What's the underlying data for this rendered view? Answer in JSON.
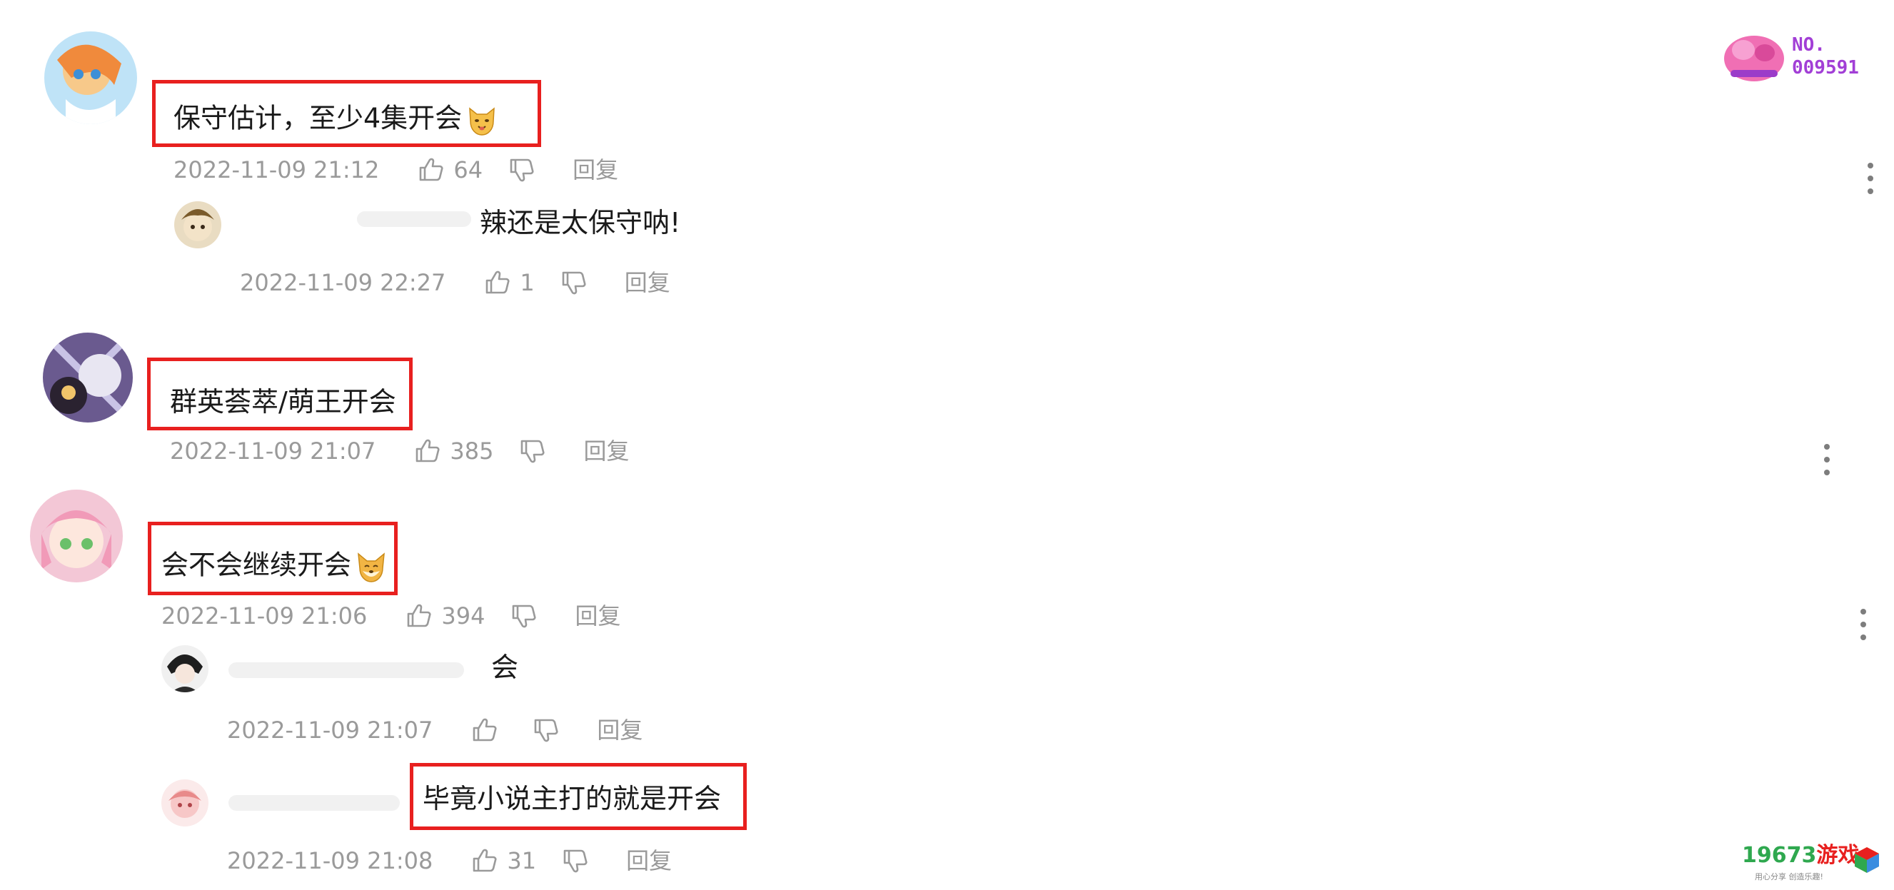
{
  "badge": {
    "line1": "NO.",
    "line2": "009591"
  },
  "watermark": {
    "brand_digits": "19673",
    "brand_cn": "游戏",
    "tagline": "用心分享 创造乐趣!"
  },
  "icons": {
    "like": "thumbs-up-icon",
    "dislike": "thumbs-down-icon",
    "more": "more-vertical-icon"
  },
  "colors": {
    "highlight_box": "#e8201f",
    "meta_text": "#9a9a9a",
    "body_text": "#1a1a1a"
  },
  "comments": [
    {
      "text": "保守估计，至少4集开会",
      "time": "2022-11-09 21:12",
      "likes": "64",
      "reply_label": "回复",
      "reply": {
        "text": "辣还是太保守呐!",
        "time": "2022-11-09 22:27",
        "likes": "1",
        "reply_label": "回复"
      }
    },
    {
      "text": "群英荟萃/萌王开会",
      "time": "2022-11-09 21:07",
      "likes": "385",
      "reply_label": "回复"
    },
    {
      "text": "会不会继续开会",
      "time": "2022-11-09 21:06",
      "likes": "394",
      "reply_label": "回复",
      "replies": [
        {
          "text": "会",
          "time": "2022-11-09 21:07",
          "likes": "",
          "reply_label": "回复"
        },
        {
          "text": "毕竟小说主打的就是开会",
          "time": "2022-11-09 21:08",
          "likes": "31",
          "reply_label": "回复"
        }
      ]
    }
  ]
}
